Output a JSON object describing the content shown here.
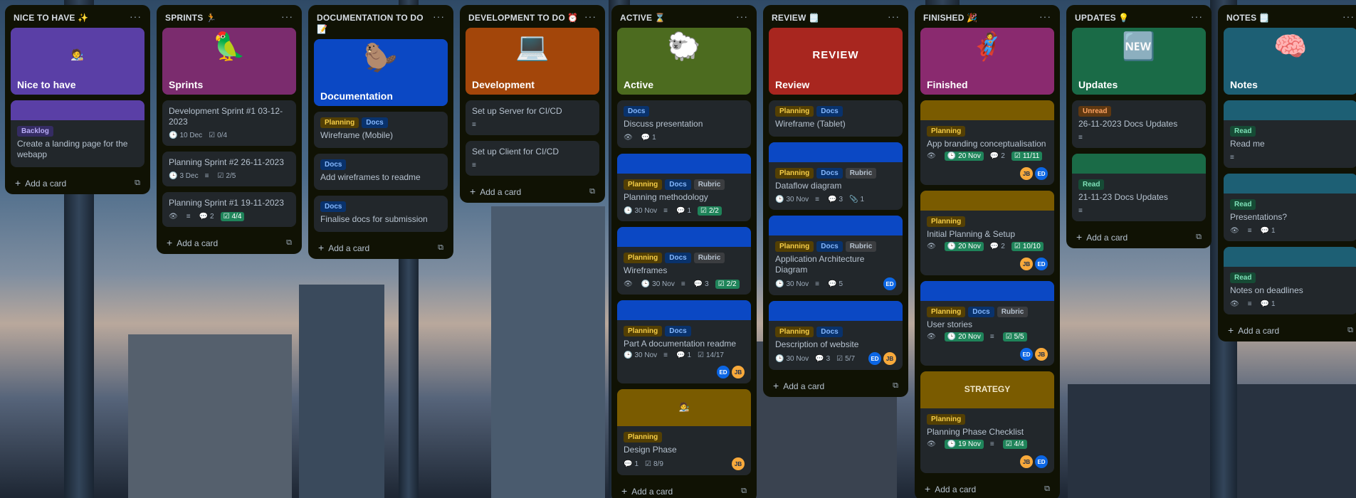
{
  "colors": {
    "list_bg": "#101204",
    "card_bg": "#22272b",
    "done_green": "#1f845a"
  },
  "add_card_label": "Add a card",
  "lists": [
    {
      "key": "nice",
      "title": "NICE TO HAVE ✨",
      "cards": [
        {
          "cover": {
            "color": "#5a3fa6",
            "art": "🧑‍🎨",
            "text": "Nice to have"
          }
        },
        {
          "strip": "#5a3fa6",
          "labels": [
            {
              "t": "Backlog",
              "c": "backlog"
            }
          ],
          "title": "Create a landing page for the webapp"
        }
      ]
    },
    {
      "key": "sprints",
      "title": "SPRINTS 🏃",
      "cards": [
        {
          "cover": {
            "color": "#7b2c6e",
            "art": "🦜",
            "text": "Sprints"
          }
        },
        {
          "title": "Development Sprint #1 03-12-2023",
          "badges": [
            {
              "i": "🕒",
              "t": "10 Dec"
            },
            {
              "i": "☑",
              "t": "0/4"
            }
          ]
        },
        {
          "title": "Planning Sprint #2 26-11-2023",
          "badges": [
            {
              "i": "🕒",
              "t": "3 Dec"
            },
            {
              "i": "≡",
              "t": ""
            },
            {
              "i": "☑",
              "t": "2/5"
            }
          ]
        },
        {
          "title": "Planning Sprint #1 19-11-2023",
          "badges": [
            {
              "i": "👁",
              "t": ""
            },
            {
              "i": "≡",
              "t": ""
            },
            {
              "i": "💬",
              "t": "2"
            },
            {
              "i": "☑",
              "t": "4/4",
              "done": true
            }
          ]
        }
      ]
    },
    {
      "key": "docs",
      "title": "DOCUMENTATION TO DO 📝",
      "cards": [
        {
          "cover": {
            "color": "#0b48c4",
            "art": "🦫",
            "text": "Documentation"
          }
        },
        {
          "labels": [
            {
              "t": "Planning",
              "c": "planning"
            },
            {
              "t": "Docs",
              "c": "docs"
            }
          ],
          "title": "Wireframe (Mobile)"
        },
        {
          "labels": [
            {
              "t": "Docs",
              "c": "docs"
            }
          ],
          "title": "Add wireframes to readme"
        },
        {
          "labels": [
            {
              "t": "Docs",
              "c": "docs"
            }
          ],
          "title": "Finalise docs for submission"
        }
      ]
    },
    {
      "key": "dev",
      "title": "DEVELOPMENT TO DO ⏰",
      "cards": [
        {
          "cover": {
            "color": "#a3460a",
            "art": "💻",
            "text": "Development"
          }
        },
        {
          "title": "Set up Server for CI/CD",
          "badges": [
            {
              "i": "≡",
              "t": ""
            }
          ]
        },
        {
          "title": "Set up Client for CI/CD",
          "badges": [
            {
              "i": "≡",
              "t": ""
            }
          ]
        }
      ]
    },
    {
      "key": "active",
      "title": "ACTIVE ⌛",
      "cards": [
        {
          "cover": {
            "color": "#4c6b1f",
            "art": "🐑",
            "text": "Active"
          }
        },
        {
          "labels": [
            {
              "t": "Docs",
              "c": "docs"
            }
          ],
          "title": "Discuss presentation",
          "badges": [
            {
              "i": "👁",
              "t": ""
            },
            {
              "i": "💬",
              "t": "1"
            }
          ]
        },
        {
          "strip": "#0b48c4",
          "labels": [
            {
              "t": "Planning",
              "c": "planning"
            },
            {
              "t": "Docs",
              "c": "docs"
            },
            {
              "t": "Rubric",
              "c": "rubric"
            }
          ],
          "title": "Planning methodology",
          "badges": [
            {
              "i": "🕒",
              "t": "30 Nov"
            },
            {
              "i": "≡",
              "t": ""
            },
            {
              "i": "💬",
              "t": "1"
            },
            {
              "i": "☑",
              "t": "2/2",
              "done": true
            }
          ]
        },
        {
          "strip": "#0b48c4",
          "labels": [
            {
              "t": "Planning",
              "c": "planning"
            },
            {
              "t": "Docs",
              "c": "docs"
            },
            {
              "t": "Rubric",
              "c": "rubric"
            }
          ],
          "title": "Wireframes",
          "badges": [
            {
              "i": "👁",
              "t": ""
            },
            {
              "i": "🕒",
              "t": "30 Nov"
            },
            {
              "i": "≡",
              "t": ""
            },
            {
              "i": "💬",
              "t": "3"
            },
            {
              "i": "☑",
              "t": "2/2",
              "done": true
            }
          ]
        },
        {
          "strip": "#0b48c4",
          "labels": [
            {
              "t": "Planning",
              "c": "planning"
            },
            {
              "t": "Docs",
              "c": "docs"
            }
          ],
          "title": "Part A documentation readme",
          "badges": [
            {
              "i": "🕒",
              "t": "30 Nov"
            },
            {
              "i": "≡",
              "t": ""
            },
            {
              "i": "💬",
              "t": "1"
            },
            {
              "i": "☑",
              "t": "14/17"
            }
          ],
          "avatars": [
            "ED",
            "JB"
          ]
        },
        {
          "coverSmall": {
            "color": "#7a5b00",
            "art": "🧑‍🎨"
          },
          "labels": [
            {
              "t": "Planning",
              "c": "planning"
            }
          ],
          "title": "Design Phase",
          "badges": [
            {
              "i": "💬",
              "t": "1"
            },
            {
              "i": "☑",
              "t": "8/9"
            }
          ],
          "avatars": [
            "JB"
          ]
        }
      ]
    },
    {
      "key": "review",
      "title": "REVIEW 🗒️",
      "cards": [
        {
          "cover": {
            "color": "#a8261f",
            "art": "REVIEW",
            "text": "Review"
          }
        },
        {
          "labels": [
            {
              "t": "Planning",
              "c": "planning"
            },
            {
              "t": "Docs",
              "c": "docs"
            }
          ],
          "title": "Wireframe (Tablet)"
        },
        {
          "strip": "#0b48c4",
          "labels": [
            {
              "t": "Planning",
              "c": "planning"
            },
            {
              "t": "Docs",
              "c": "docs"
            },
            {
              "t": "Rubric",
              "c": "rubric"
            }
          ],
          "title": "Dataflow diagram",
          "badges": [
            {
              "i": "🕒",
              "t": "30 Nov"
            },
            {
              "i": "≡",
              "t": ""
            },
            {
              "i": "💬",
              "t": "3"
            },
            {
              "i": "📎",
              "t": "1"
            }
          ]
        },
        {
          "strip": "#0b48c4",
          "labels": [
            {
              "t": "Planning",
              "c": "planning"
            },
            {
              "t": "Docs",
              "c": "docs"
            },
            {
              "t": "Rubric",
              "c": "rubric"
            }
          ],
          "title": "Application Architecture Diagram",
          "badges": [
            {
              "i": "🕒",
              "t": "30 Nov"
            },
            {
              "i": "≡",
              "t": ""
            },
            {
              "i": "💬",
              "t": "5"
            }
          ],
          "avatars": [
            "ED"
          ]
        },
        {
          "strip": "#0b48c4",
          "labels": [
            {
              "t": "Planning",
              "c": "planning"
            },
            {
              "t": "Docs",
              "c": "docs"
            }
          ],
          "title": "Description of website",
          "badges": [
            {
              "i": "🕒",
              "t": "30 Nov"
            },
            {
              "i": "💬",
              "t": "3"
            },
            {
              "i": "☑",
              "t": "5/7"
            }
          ],
          "avatars": [
            "ED",
            "JB"
          ]
        }
      ]
    },
    {
      "key": "finished",
      "title": "FINISHED 🎉",
      "cards": [
        {
          "cover": {
            "color": "#8a2a6f",
            "art": "🦸",
            "text": "Finished"
          }
        },
        {
          "strip": "#7a5b00",
          "labels": [
            {
              "t": "Planning",
              "c": "planning"
            }
          ],
          "title": "App branding conceptualisation",
          "badges": [
            {
              "i": "👁",
              "t": ""
            },
            {
              "i": "🕒",
              "t": "20 Nov",
              "done": true
            },
            {
              "i": "💬",
              "t": "2"
            },
            {
              "i": "☑",
              "t": "11/11",
              "done": true
            }
          ],
          "avatars": [
            "JB",
            "ED"
          ]
        },
        {
          "strip": "#7a5b00",
          "labels": [
            {
              "t": "Planning",
              "c": "planning"
            }
          ],
          "title": "Initial Planning & Setup",
          "badges": [
            {
              "i": "👁",
              "t": ""
            },
            {
              "i": "🕒",
              "t": "20 Nov",
              "done": true
            },
            {
              "i": "💬",
              "t": "2"
            },
            {
              "i": "☑",
              "t": "10/10",
              "done": true
            }
          ],
          "avatars": [
            "JB",
            "ED"
          ]
        },
        {
          "strip": "#0b48c4",
          "labels": [
            {
              "t": "Planning",
              "c": "planning"
            },
            {
              "t": "Docs",
              "c": "docs"
            },
            {
              "t": "Rubric",
              "c": "rubric"
            }
          ],
          "title": "User stories",
          "badges": [
            {
              "i": "👁",
              "t": ""
            },
            {
              "i": "🕒",
              "t": "20 Nov",
              "done": true
            },
            {
              "i": "≡",
              "t": ""
            },
            {
              "i": "☑",
              "t": "5/5",
              "done": true
            }
          ],
          "avatars": [
            "ED",
            "JB"
          ]
        },
        {
          "coverSmall": {
            "color": "#7a5b00",
            "art": "STRATEGY"
          },
          "labels": [
            {
              "t": "Planning",
              "c": "planning"
            }
          ],
          "title": "Planning Phase Checklist",
          "badges": [
            {
              "i": "👁",
              "t": ""
            },
            {
              "i": "🕒",
              "t": "19 Nov",
              "done": true
            },
            {
              "i": "≡",
              "t": ""
            },
            {
              "i": "☑",
              "t": "4/4",
              "done": true
            }
          ],
          "avatars": [
            "JB",
            "ED"
          ]
        }
      ]
    },
    {
      "key": "updates",
      "title": "UPDATES 💡",
      "cards": [
        {
          "cover": {
            "color": "#1a6b47",
            "art": "🆕",
            "text": "Updates"
          }
        },
        {
          "labels": [
            {
              "t": "Unread",
              "c": "unread"
            }
          ],
          "title": "26-11-2023 Docs Updates",
          "badges": [
            {
              "i": "≡",
              "t": ""
            }
          ]
        },
        {
          "strip": "#1a6b47",
          "labels": [
            {
              "t": "Read",
              "c": "read"
            }
          ],
          "title": "21-11-23 Docs Updates",
          "badges": [
            {
              "i": "≡",
              "t": ""
            }
          ]
        }
      ]
    },
    {
      "key": "notes",
      "title": "NOTES 🗒️",
      "cards": [
        {
          "cover": {
            "color": "#1d5f74",
            "art": "🧠",
            "text": "Notes"
          }
        },
        {
          "strip": "#1d5f74",
          "labels": [
            {
              "t": "Read",
              "c": "read"
            }
          ],
          "title": "Read me",
          "badges": [
            {
              "i": "≡",
              "t": ""
            }
          ]
        },
        {
          "strip": "#1d5f74",
          "labels": [
            {
              "t": "Read",
              "c": "read"
            }
          ],
          "title": "Presentations?",
          "badges": [
            {
              "i": "👁",
              "t": ""
            },
            {
              "i": "≡",
              "t": ""
            },
            {
              "i": "💬",
              "t": "1"
            }
          ]
        },
        {
          "strip": "#1d5f74",
          "labels": [
            {
              "t": "Read",
              "c": "read"
            }
          ],
          "title": "Notes on deadlines",
          "badges": [
            {
              "i": "👁",
              "t": ""
            },
            {
              "i": "≡",
              "t": ""
            },
            {
              "i": "💬",
              "t": "1"
            }
          ]
        }
      ]
    }
  ]
}
